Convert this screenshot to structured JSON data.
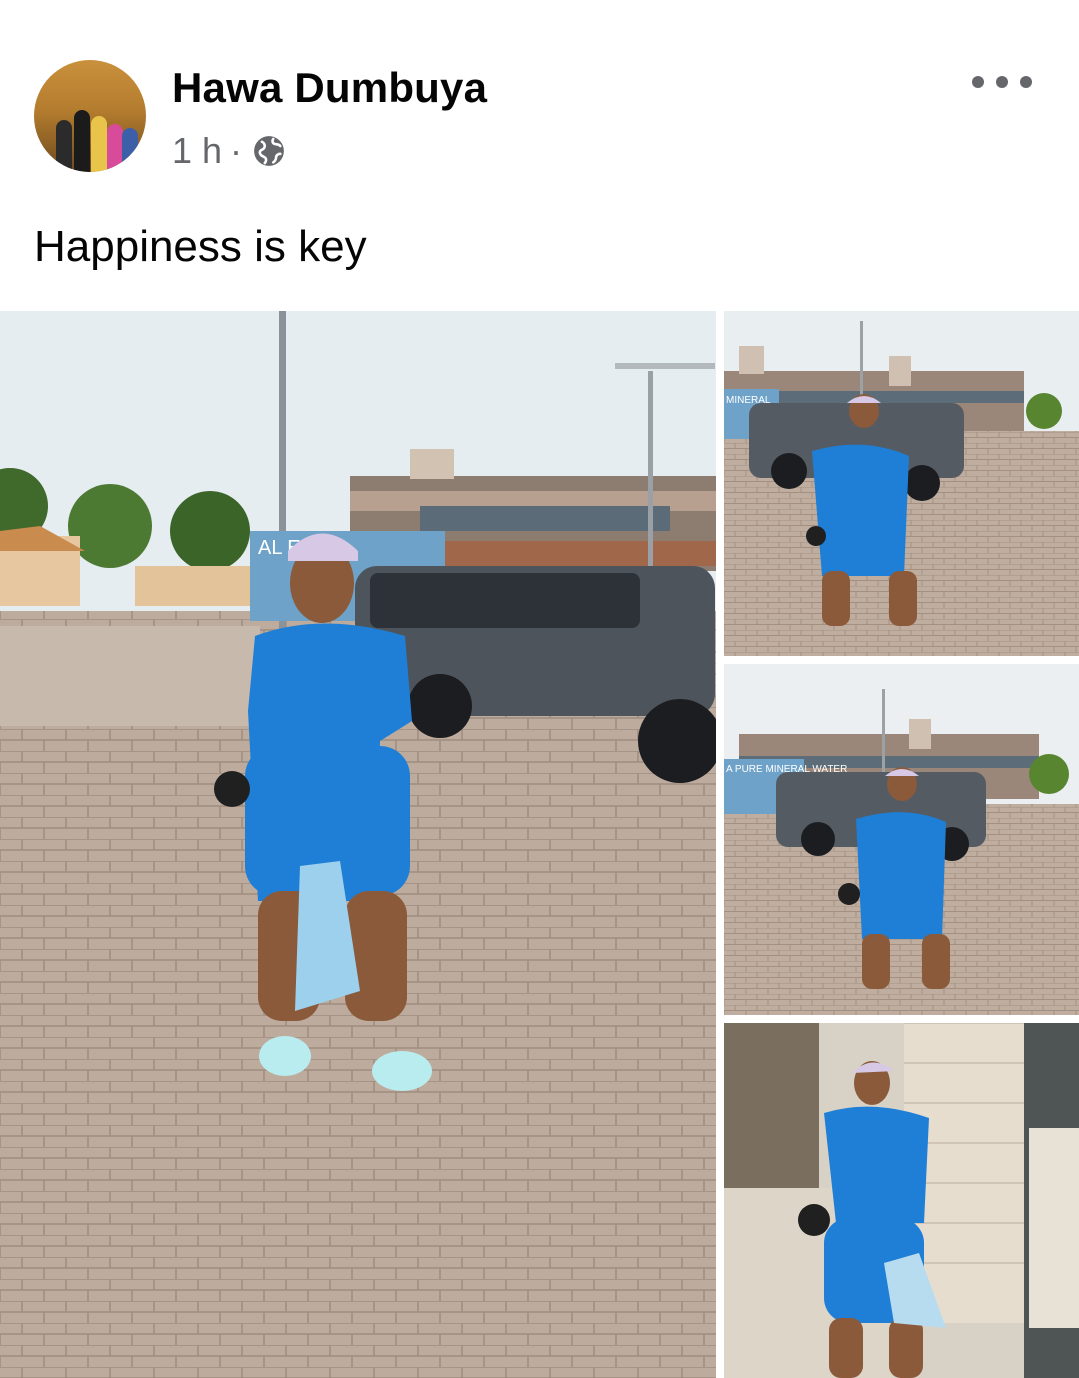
{
  "post": {
    "author": "Hawa Dumbuya",
    "time": "1 h",
    "separator": "·",
    "audience_icon": "globe-icon",
    "more_icon": "more-horizontal-icon",
    "caption": "Happiness is key"
  },
  "photos": [
    {
      "id": "photo-1",
      "sign_text": "AL ERAL"
    },
    {
      "id": "photo-2",
      "sign_text": "MINERAL"
    },
    {
      "id": "photo-3",
      "sign_text": "A PURE MINERAL WATER"
    },
    {
      "id": "photo-4"
    }
  ],
  "colors": {
    "outfit_blue": "#1f7fd6",
    "sky": "#e9eef2",
    "pavement": "#b9a89b",
    "meta_gray": "#65676b"
  }
}
